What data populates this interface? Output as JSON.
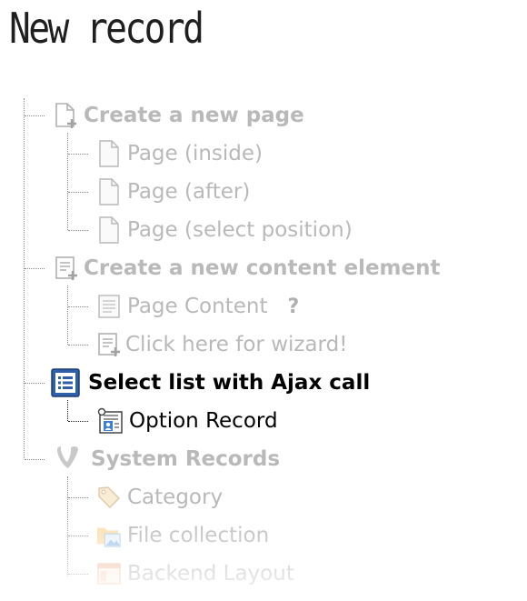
{
  "page_title": "New record",
  "tree": {
    "create_page": {
      "label": "Create a new page",
      "items": [
        "Page (inside)",
        "Page (after)",
        "Page (select position)"
      ]
    },
    "create_content": {
      "label": "Create a new content element",
      "items": [
        "Page Content",
        "Click here for wizard!"
      ],
      "help_mark": "?"
    },
    "ajax_group": {
      "label": "Select list with Ajax call",
      "items": [
        "Option Record"
      ]
    },
    "system_records": {
      "label": "System Records",
      "items": [
        "Category",
        "File collection",
        "Backend Layout"
      ]
    }
  },
  "icons": {
    "page_new": "page-new-icon",
    "page": "page-icon",
    "content_new": "content-new-icon",
    "content": "content-icon",
    "list": "list-icon",
    "record": "record-icon",
    "typo3": "typo3-logo-icon",
    "category": "tag-icon",
    "file_collection": "folder-image-icon",
    "backend_layout": "layout-icon"
  },
  "colors": {
    "active_group_icon": "#2f5fa8",
    "dim_text": "#b9b9b9"
  }
}
